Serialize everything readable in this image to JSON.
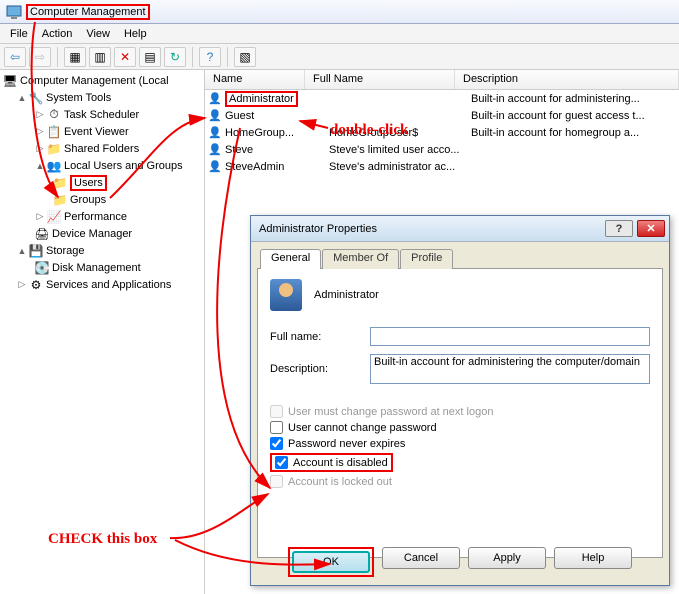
{
  "window": {
    "title": "Computer Management"
  },
  "menu": {
    "file": "File",
    "action": "Action",
    "view": "View",
    "help": "Help"
  },
  "tree": {
    "root": "Computer Management (Local",
    "system_tools": "System Tools",
    "task_scheduler": "Task Scheduler",
    "event_viewer": "Event Viewer",
    "shared_folders": "Shared Folders",
    "local_users": "Local Users and Groups",
    "users": "Users",
    "groups": "Groups",
    "performance": "Performance",
    "device_manager": "Device Manager",
    "storage": "Storage",
    "disk_management": "Disk Management",
    "services": "Services and Applications"
  },
  "list": {
    "headers": {
      "name": "Name",
      "fullname": "Full Name",
      "desc": "Description"
    },
    "rows": [
      {
        "name": "Administrator",
        "full": "",
        "desc": "Built-in account for administering..."
      },
      {
        "name": "Guest",
        "full": "",
        "desc": "Built-in account for guest access t..."
      },
      {
        "name": "HomeGroup...",
        "full": "HomeGroupUser$",
        "desc": "Built-in account for homegroup a..."
      },
      {
        "name": "Steve",
        "full": "Steve's limited user acco...",
        "desc": ""
      },
      {
        "name": "SteveAdmin",
        "full": "Steve's administrator ac...",
        "desc": ""
      }
    ]
  },
  "dialog": {
    "title": "Administrator Properties",
    "tabs": {
      "general": "General",
      "member": "Member Of",
      "profile": "Profile"
    },
    "username": "Administrator",
    "fullname_label": "Full name:",
    "fullname": "",
    "desc_label": "Description:",
    "desc_value": "Built-in account for administering the computer/domain",
    "chk_must_change": "User must change password at next logon",
    "chk_cannot_change": "User cannot change password",
    "chk_never_expires": "Password never expires",
    "chk_disabled": "Account is disabled",
    "chk_locked": "Account is locked out",
    "btn_ok": "OK",
    "btn_cancel": "Cancel",
    "btn_apply": "Apply",
    "btn_help": "Help"
  },
  "annotations": {
    "double_click": "double-click",
    "check_this": "CHECK this box"
  }
}
